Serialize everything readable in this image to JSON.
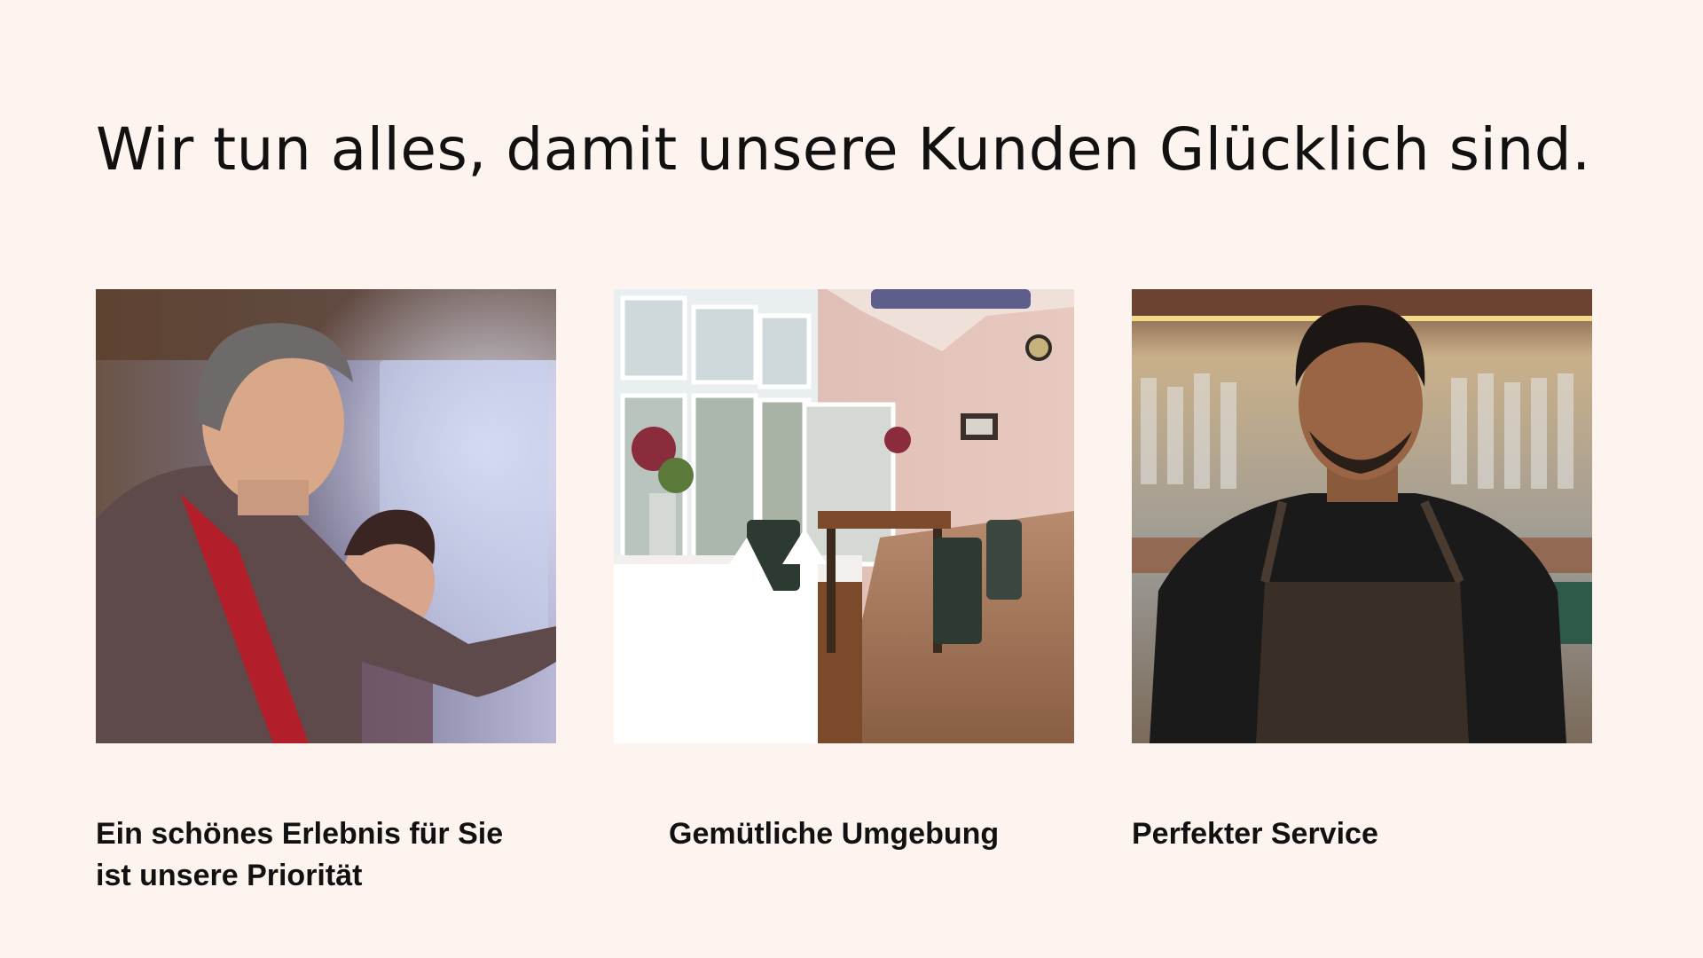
{
  "headline": "Wir tun alles, damit unsere Kunden Glücklich sind.",
  "features": [
    {
      "caption": "Ein schönes Erlebnis für Sie ist unsere Priorität",
      "image": "chef-cooking-photo"
    },
    {
      "caption": "Gemütliche Umgebung",
      "image": "restaurant-interior-photo"
    },
    {
      "caption": "Perfekter Service",
      "image": "waiter-portrait-photo"
    }
  ],
  "colors": {
    "background": "#fdf3ef",
    "text": "#111111"
  }
}
